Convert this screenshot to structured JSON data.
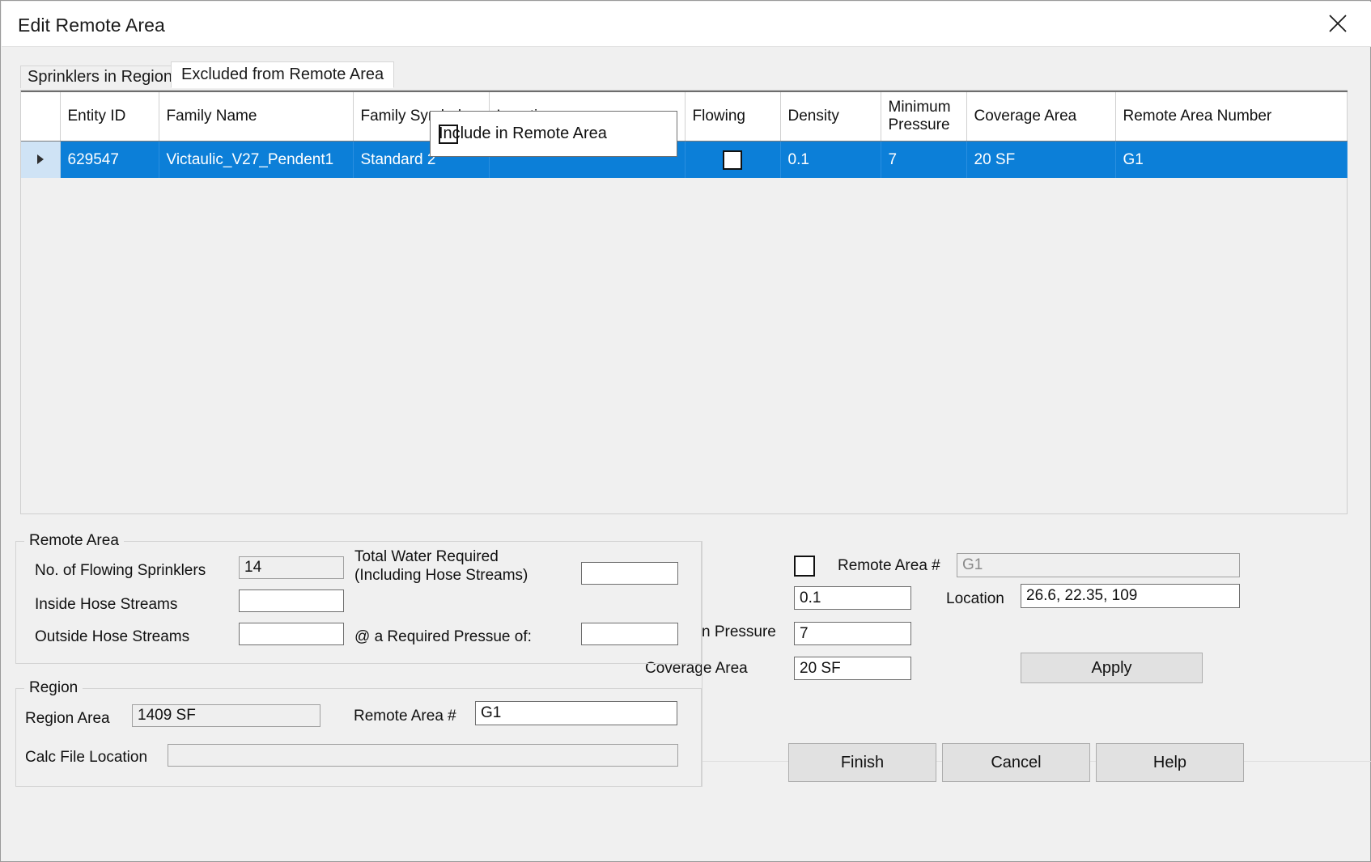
{
  "window": {
    "title": "Edit Remote Area",
    "close_icon": "close-icon"
  },
  "tabs": [
    {
      "label": "Sprinklers in Region",
      "active": false
    },
    {
      "label": "Excluded from Remote Area",
      "active": true
    }
  ],
  "grid": {
    "columns": [
      "",
      "Entity ID",
      "Family Name",
      "Family Symbol",
      "Location",
      "Flowing",
      "Density",
      "Minimum Pressure",
      "Coverage Area",
      "Remote Area Number"
    ],
    "rows": [
      {
        "selected": true,
        "entity_id": "629547",
        "family_name": "Victaulic_V27_Pendent1",
        "family_symbol": "Standard 2",
        "location": "",
        "flowing": false,
        "density": "0.1",
        "minimum_pressure": "7",
        "coverage_area": "20 SF",
        "remote_area_number": "G1"
      }
    ]
  },
  "popup": {
    "checkbox_label": "Include in Remote Area",
    "checked": false
  },
  "remote_area_group": {
    "legend": "Remote Area",
    "no_flowing_sprinklers_label": "No. of Flowing Sprinklers",
    "no_flowing_sprinklers_value": "14",
    "inside_hose_streams_label": "Inside Hose Streams",
    "inside_hose_streams_value": "",
    "outside_hose_streams_label": "Outside Hose Streams",
    "outside_hose_streams_value": "",
    "total_water_label_line1": "Total Water Required",
    "total_water_label_line2": "(Including Hose Streams)",
    "total_water_value": "",
    "required_pressure_label": "@ a Required Pressue of:",
    "required_pressure_value": ""
  },
  "region_group": {
    "legend": "Region",
    "region_area_label": "Region Area",
    "region_area_value": "1409 SF",
    "remote_area_number_label": "Remote Area #",
    "remote_area_number_value": "G1",
    "calc_file_location_label": "Calc File Location",
    "calc_file_location_value": ""
  },
  "detail_panel": {
    "remote_area_checkbox_checked": false,
    "remote_area_number_label": "Remote Area #",
    "remote_area_number_value": "G1",
    "location_label": "Location",
    "location_value": "26.6, 22.35, 109",
    "density_value": "0.1",
    "minimum_pressure_label": "n Pressure",
    "minimum_pressure_value": "7",
    "coverage_area_label": "Coverage Area",
    "coverage_area_value": "20 SF",
    "apply_label": "Apply"
  },
  "footer": {
    "finish_label": "Finish",
    "cancel_label": "Cancel",
    "help_label": "Help"
  },
  "colors": {
    "selection_blue": "#0c7fd8",
    "row_header_blue": "#cfe3f5",
    "dialog_bg": "#f0f0f0",
    "button_bg": "#e1e1e1"
  }
}
